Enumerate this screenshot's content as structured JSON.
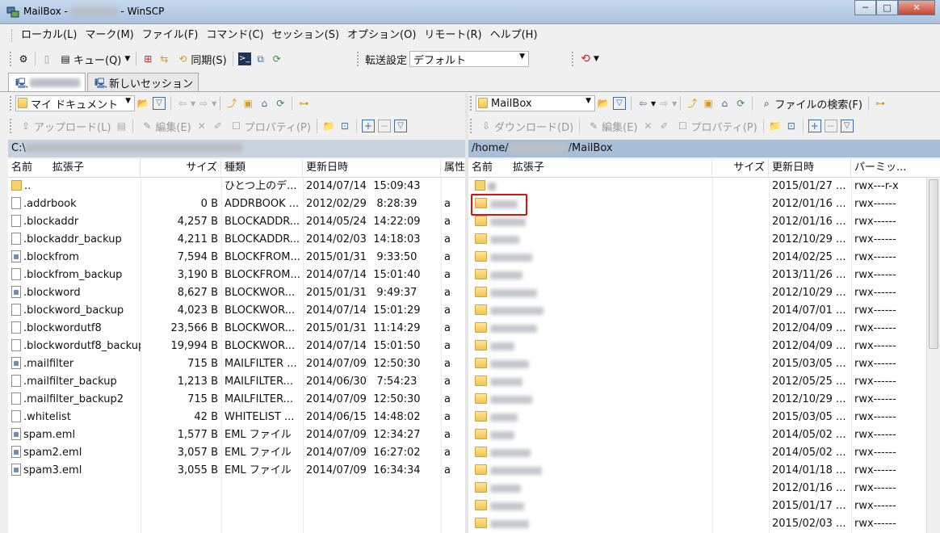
{
  "window": {
    "title_prefix": "MailBox - ",
    "title_suffix": " - WinSCP",
    "buttons": [
      "─",
      "□",
      "✕"
    ]
  },
  "menu": [
    "ローカル(L)",
    "マーク(M)",
    "ファイル(F)",
    "コマンド(C)",
    "セッション(S)",
    "オプション(O)",
    "リモート(R)",
    "ヘルプ(H)"
  ],
  "toolbar": {
    "queue_label": "キュー(Q)",
    "sync_label": "同期(S)",
    "transfer_label": "転送設定",
    "transfer_value": "デフォルト"
  },
  "tabs": {
    "new_session": "新しいセッション"
  },
  "left": {
    "location": "マイ ドキュメント",
    "upload": "アップロード(L)",
    "edit": "編集(E)",
    "properties": "プロパティ(P)",
    "path_prefix": "C:\\",
    "columns": [
      "名前",
      "拡張子",
      "サイズ",
      "種類",
      "更新日時",
      "属性"
    ],
    "files": [
      {
        "name": "..",
        "size": "",
        "type": "ひとつ上のデ...",
        "date": "2014/07/14  15:09:43",
        "attr": "",
        "icon": "up"
      },
      {
        "name": ".addrbook",
        "size": "0 B",
        "type": "ADDRBOOK ...",
        "date": "2012/02/29   8:28:39",
        "attr": "a",
        "icon": "file"
      },
      {
        "name": ".blockaddr",
        "size": "4,257 B",
        "type": "BLOCKADDR...",
        "date": "2014/05/24  14:22:09",
        "attr": "a",
        "icon": "file"
      },
      {
        "name": ".blockaddr_backup",
        "size": "4,211 B",
        "type": "BLOCKADDR...",
        "date": "2014/02/03  14:18:03",
        "attr": "a",
        "icon": "file"
      },
      {
        "name": ".blockfrom",
        "size": "7,594 B",
        "type": "BLOCKFROM...",
        "date": "2015/01/31   9:33:50",
        "attr": "a",
        "icon": "doc"
      },
      {
        "name": ".blockfrom_backup",
        "size": "3,190 B",
        "type": "BLOCKFROM...",
        "date": "2014/07/14  15:01:40",
        "attr": "a",
        "icon": "file"
      },
      {
        "name": ".blockword",
        "size": "8,627 B",
        "type": "BLOCKWOR...",
        "date": "2015/01/31   9:49:37",
        "attr": "a",
        "icon": "doc"
      },
      {
        "name": ".blockword_backup",
        "size": "4,023 B",
        "type": "BLOCKWOR...",
        "date": "2014/07/14  15:01:29",
        "attr": "a",
        "icon": "file"
      },
      {
        "name": ".blockwordutf8",
        "size": "23,566 B",
        "type": "BLOCKWOR...",
        "date": "2015/01/31  11:14:29",
        "attr": "a",
        "icon": "file"
      },
      {
        "name": ".blockwordutf8_backup",
        "size": "19,994 B",
        "type": "BLOCKWOR...",
        "date": "2014/07/14  15:01:50",
        "attr": "a",
        "icon": "file"
      },
      {
        "name": ".mailfilter",
        "size": "715 B",
        "type": "MAILFILTER ...",
        "date": "2014/07/09  12:50:30",
        "attr": "a",
        "icon": "doc"
      },
      {
        "name": ".mailfilter_backup",
        "size": "1,213 B",
        "type": "MAILFILTER...",
        "date": "2014/06/30   7:54:23",
        "attr": "a",
        "icon": "file"
      },
      {
        "name": ".mailfilter_backup2",
        "size": "715 B",
        "type": "MAILFILTER...",
        "date": "2014/07/09  12:50:30",
        "attr": "a",
        "icon": "file"
      },
      {
        "name": ".whitelist",
        "size": "42 B",
        "type": "WHITELIST ...",
        "date": "2014/06/15  14:48:02",
        "attr": "a",
        "icon": "file"
      },
      {
        "name": "spam.eml",
        "size": "1,577 B",
        "type": "EML ファイル",
        "date": "2014/07/09  12:34:27",
        "attr": "a",
        "icon": "doc"
      },
      {
        "name": "spam2.eml",
        "size": "3,057 B",
        "type": "EML ファイル",
        "date": "2014/07/09  16:27:02",
        "attr": "a",
        "icon": "doc"
      },
      {
        "name": "spam3.eml",
        "size": "3,055 B",
        "type": "EML ファイル",
        "date": "2014/07/09  16:34:34",
        "attr": "a",
        "icon": "doc"
      }
    ]
  },
  "right": {
    "location": "MailBox",
    "download": "ダウンロード(D)",
    "edit": "編集(E)",
    "properties": "プロパティ(P)",
    "find": "ファイルの検索(F)",
    "path_prefix": "/home/",
    "path_suffix": "/MailBox",
    "columns": [
      "名前",
      "拡張子",
      "サイズ",
      "更新日時",
      "パーミッ..."
    ],
    "files": [
      {
        "date": "2015/01/27 ...",
        "perm": "rwx---r-x",
        "up": true
      },
      {
        "date": "2012/01/16 ...",
        "perm": "rwx------"
      },
      {
        "date": "2012/01/16 ...",
        "perm": "rwx------"
      },
      {
        "date": "2012/10/29 ...",
        "perm": "rwx------"
      },
      {
        "date": "2014/02/25 ...",
        "perm": "rwx------"
      },
      {
        "date": "2013/11/26 ...",
        "perm": "rwx------"
      },
      {
        "date": "2012/10/29 ...",
        "perm": "rwx------"
      },
      {
        "date": "2014/07/01 ...",
        "perm": "rwx------"
      },
      {
        "date": "2012/04/09 ...",
        "perm": "rwx------"
      },
      {
        "date": "2012/04/09 ...",
        "perm": "rwx------"
      },
      {
        "date": "2015/03/05 ...",
        "perm": "rwx------"
      },
      {
        "date": "2012/05/25 ...",
        "perm": "rwx------"
      },
      {
        "date": "2012/10/29 ...",
        "perm": "rwx------"
      },
      {
        "date": "2015/03/05 ...",
        "perm": "rwx------"
      },
      {
        "date": "2014/05/02 ...",
        "perm": "rwx------"
      },
      {
        "date": "2014/05/02 ...",
        "perm": "rwx------"
      },
      {
        "date": "2014/01/18 ...",
        "perm": "rwx------"
      },
      {
        "date": "2012/01/16 ...",
        "perm": "rwx------"
      },
      {
        "date": "2015/01/17 ...",
        "perm": "rwx------"
      },
      {
        "date": "2015/02/03 ...",
        "perm": "rwx------"
      }
    ]
  },
  "colors": {
    "highlight_box": "#e01010",
    "path_active": "#a8bdd6"
  }
}
